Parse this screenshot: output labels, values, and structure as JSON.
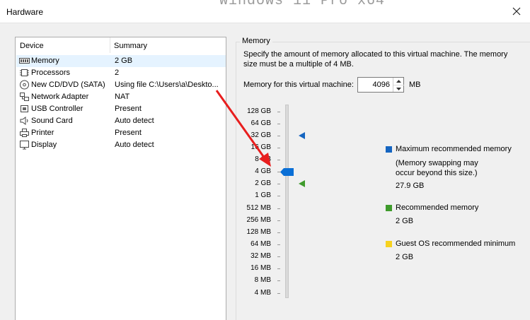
{
  "window": {
    "title": "Hardware",
    "background_text": "Windows 11 Pro x64"
  },
  "device_list": {
    "headers": {
      "device": "Device",
      "summary": "Summary"
    },
    "items": [
      {
        "name": "Memory",
        "summary": "2 GB",
        "icon": "memory-icon",
        "selected": true
      },
      {
        "name": "Processors",
        "summary": "2",
        "icon": "processor-icon"
      },
      {
        "name": "New CD/DVD (SATA)",
        "summary": "Using file C:\\Users\\a\\Deskto...",
        "icon": "cd-dvd-icon"
      },
      {
        "name": "Network Adapter",
        "summary": "NAT",
        "icon": "network-adapter-icon"
      },
      {
        "name": "USB Controller",
        "summary": "Present",
        "icon": "usb-controller-icon"
      },
      {
        "name": "Sound Card",
        "summary": "Auto detect",
        "icon": "sound-card-icon"
      },
      {
        "name": "Printer",
        "summary": "Present",
        "icon": "printer-icon"
      },
      {
        "name": "Display",
        "summary": "Auto detect",
        "icon": "display-icon"
      }
    ]
  },
  "memory": {
    "group_title": "Memory",
    "description": "Specify the amount of memory allocated to this virtual machine. The memory size must be a multiple of 4 MB.",
    "field_label": "Memory for this virtual machine:",
    "value": "4096",
    "unit": "MB",
    "slider": {
      "ticks": [
        "128 GB",
        "64 GB",
        "32 GB",
        "16 GB",
        "8 GB",
        "4 GB",
        "2 GB",
        "1 GB",
        "512 MB",
        "256 MB",
        "128 MB",
        "64 MB",
        "32 MB",
        "16 MB",
        "8 MB",
        "4 MB"
      ],
      "current": "4 GB",
      "max_recommended": "32 GB",
      "recommended": "2 GB"
    },
    "legend": {
      "max": {
        "label": "Maximum recommended memory",
        "note": "(Memory swapping may occur beyond this size.)",
        "value": "27.9 GB",
        "color": "#1565c0"
      },
      "recommended": {
        "label": "Recommended memory",
        "value": "2 GB",
        "color": "#3f9b2c"
      },
      "guest_min": {
        "label": "Guest OS recommended minimum",
        "value": "2 GB",
        "color": "#f7d21f"
      }
    }
  },
  "annotation": {
    "color": "#e81e1e"
  }
}
